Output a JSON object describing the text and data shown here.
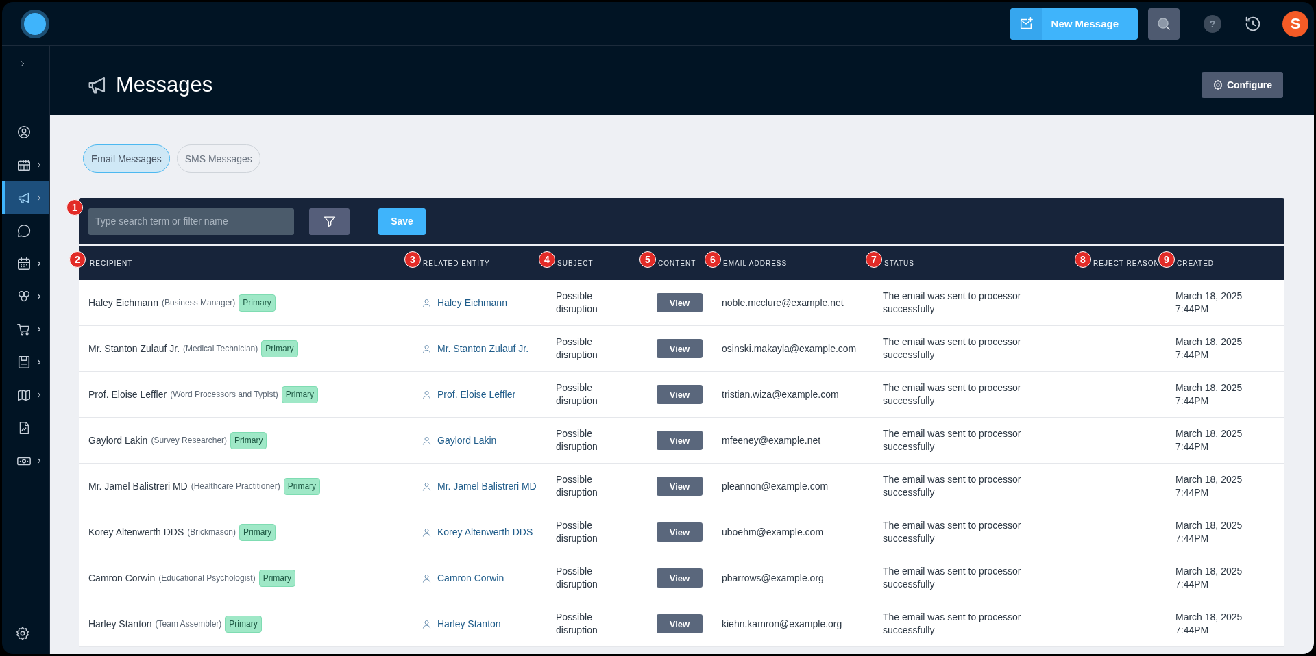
{
  "top_bar": {
    "new_message_label": "New Message",
    "help_label": "?",
    "avatar_initial": "S"
  },
  "sidebar": {
    "items": [
      {
        "selected": false,
        "has_submenu": false
      },
      {
        "selected": false,
        "has_submenu": true
      },
      {
        "selected": true,
        "has_submenu": true
      },
      {
        "selected": false,
        "has_submenu": false
      },
      {
        "selected": false,
        "has_submenu": true
      },
      {
        "selected": false,
        "has_submenu": true
      },
      {
        "selected": false,
        "has_submenu": true
      },
      {
        "selected": false,
        "has_submenu": true
      },
      {
        "selected": false,
        "has_submenu": true
      },
      {
        "selected": false,
        "has_submenu": false
      },
      {
        "selected": false,
        "has_submenu": true
      }
    ]
  },
  "page": {
    "title": "Messages",
    "configure_label": "Configure"
  },
  "tabs": [
    {
      "label": "Email Messages",
      "selected": true
    },
    {
      "label": "SMS Messages",
      "selected": false
    }
  ],
  "filter_bar": {
    "marker": "1",
    "placeholder": "Type search term or filter name",
    "save_label": "Save"
  },
  "table": {
    "columns": [
      {
        "label": "RECIPIENT",
        "marker": "2"
      },
      {
        "label": "RELATED ENTITY",
        "marker": "3"
      },
      {
        "label": "SUBJECT",
        "marker": "4"
      },
      {
        "label": "CONTENT",
        "marker": "5"
      },
      {
        "label": "EMAIL ADDRESS",
        "marker": "6"
      },
      {
        "label": "STATUS",
        "marker": "7"
      },
      {
        "label": "REJECT REASON",
        "marker": "8"
      },
      {
        "label": "CREATED",
        "marker": "9"
      }
    ],
    "rows": [
      {
        "name": "Haley Eichmann",
        "role": "(Business Manager)",
        "badge": "Primary",
        "related_entity": "Haley Eichmann",
        "subject": "Possible disruption",
        "content_button": "View",
        "email": "noble.mcclure@example.net",
        "status": "The email was sent to processor successfully",
        "created": "March 18, 2025 7:44PM"
      },
      {
        "name": "Mr. Stanton Zulauf Jr.",
        "role": "(Medical Technician)",
        "badge": "Primary",
        "related_entity": "Mr. Stanton Zulauf Jr.",
        "subject": "Possible disruption",
        "content_button": "View",
        "email": "osinski.makayla@example.com",
        "status": "The email was sent to processor successfully",
        "created": "March 18, 2025 7:44PM"
      },
      {
        "name": "Prof. Eloise Leffler",
        "role": "(Word Processors and Typist)",
        "badge": "Primary",
        "related_entity": "Prof. Eloise Leffler",
        "subject": "Possible disruption",
        "content_button": "View",
        "email": "tristian.wiza@example.com",
        "status": "The email was sent to processor successfully",
        "created": "March 18, 2025 7:44PM"
      },
      {
        "name": "Gaylord Lakin",
        "role": "(Survey Researcher)",
        "badge": "Primary",
        "related_entity": "Gaylord Lakin",
        "subject": "Possible disruption",
        "content_button": "View",
        "email": "mfeeney@example.net",
        "status": "The email was sent to processor successfully",
        "created": "March 18, 2025 7:44PM"
      },
      {
        "name": "Mr. Jamel Balistreri MD",
        "role": "(Healthcare Practitioner)",
        "badge": "Primary",
        "related_entity": "Mr. Jamel Balistreri MD",
        "subject": "Possible disruption",
        "content_button": "View",
        "email": "pleannon@example.com",
        "status": "The email was sent to processor successfully",
        "created": "March 18, 2025 7:44PM"
      },
      {
        "name": "Korey Altenwerth DDS",
        "role": "(Brickmason)",
        "badge": "Primary",
        "related_entity": "Korey Altenwerth DDS",
        "subject": "Possible disruption",
        "content_button": "View",
        "email": "uboehm@example.com",
        "status": "The email was sent to processor successfully",
        "created": "March 18, 2025 7:44PM"
      },
      {
        "name": "Camron Corwin",
        "role": "(Educational Psychologist)",
        "badge": "Primary",
        "related_entity": "Camron Corwin",
        "subject": "Possible disruption",
        "content_button": "View",
        "email": "pbarrows@example.org",
        "status": "The email was sent to processor successfully",
        "created": "March 18, 2025 7:44PM"
      },
      {
        "name": "Harley Stanton",
        "role": "(Team Assembler)",
        "badge": "Primary",
        "related_entity": "Harley Stanton",
        "subject": "Possible disruption",
        "content_button": "View",
        "email": "kiehn.kamron@example.org",
        "status": "The email was sent to processor successfully",
        "created": "March 18, 2025 7:44PM"
      }
    ]
  }
}
